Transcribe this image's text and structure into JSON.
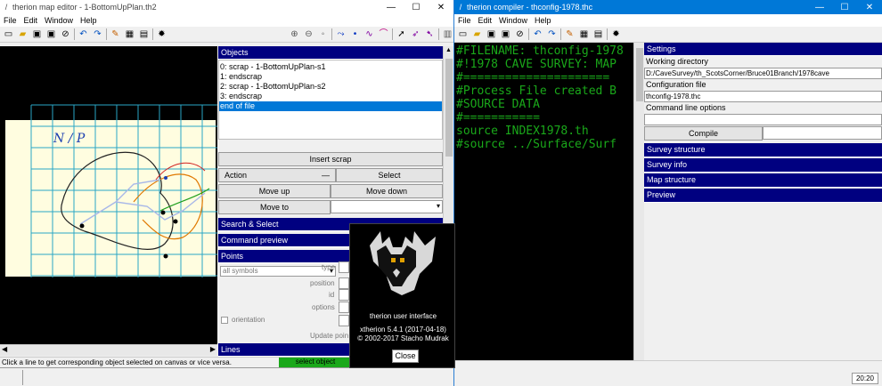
{
  "map_editor": {
    "title": "therion map editor - 1-BottomUpPlan.th2",
    "menu": [
      "File",
      "Edit",
      "Window",
      "Help"
    ],
    "objects_header": "Objects",
    "objects": [
      "0: scrap - 1-BottomUpPlan-s1",
      "1: endscrap",
      "2: scrap - 1-BottomUpPlan-s2",
      "3: endscrap",
      "end of file"
    ],
    "selected_object_index": 4,
    "insert_scrap": "Insert scrap",
    "action": "Action",
    "select": "Select",
    "move_up": "Move up",
    "move_down": "Move down",
    "move_to": "Move to",
    "search_select": "Search & Select",
    "command_preview": "Command preview",
    "points": "Points",
    "all_symbols": "all symbols",
    "type_label": "type",
    "position_label": "position",
    "id_label": "id",
    "options_label": "options",
    "orientation_label": "orientation",
    "update_point": "Update poin",
    "lines": "Lines",
    "status": "Click a line to get corresponding object selected on canvas or vice versa.",
    "select_object": "select object",
    "handwriting": "N / P"
  },
  "compiler": {
    "title": "therion compiler - thconfig-1978.thc",
    "menu": [
      "File",
      "Edit",
      "Window",
      "Help"
    ],
    "code_lines": [
      "#FILENAME: thconfig-1978",
      "",
      "#!1978 CAVE SURVEY: MAP",
      "#=====================",
      "",
      "#Process File created B",
      "",
      "#SOURCE DATA",
      "#===========",
      "source INDEX1978.th",
      "#source ../Surface/Surf"
    ],
    "settings": "Settings",
    "working_directory_label": "Working directory",
    "working_directory": "D:/CaveSurvey/th_ScotsCorner/Bruce01Branch/1978cave",
    "configuration_file_label": "Configuration file",
    "configuration_file": "thconfig-1978.thc",
    "command_line_label": "Command line options",
    "compile": "Compile",
    "survey_structure": "Survey structure",
    "survey_info": "Survey info",
    "map_structure": "Map structure",
    "preview": "Preview",
    "status_time": "20:20"
  },
  "about": {
    "line1": "therion user interface",
    "line2": "xtherion 5.4.1 (2017-04-18)",
    "line3": "© 2002-2017 Stacho Mudrak",
    "close": "Close"
  },
  "colors": {
    "active_title": "#0078d7",
    "panel_header": "#000080",
    "code_green": "#1aa81a",
    "paper": "#fffde0"
  }
}
